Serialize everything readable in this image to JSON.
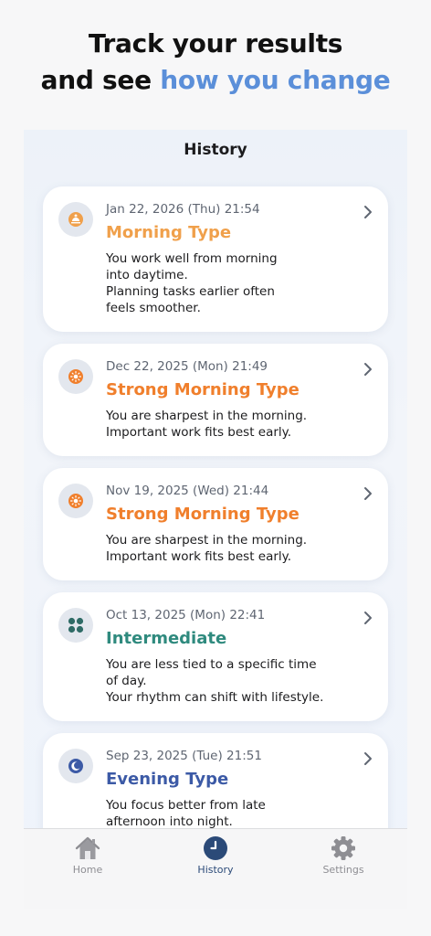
{
  "promo": {
    "line1": "Track your results",
    "line2_prefix": "and see ",
    "line2_accent": "how you change"
  },
  "screen": {
    "title": "History"
  },
  "history": [
    {
      "date": "Jan 22, 2026 (Thu) 21:54",
      "type": "Morning Type",
      "type_color": "#f0a04b",
      "icon": "sunrise-icon",
      "description": [
        "You work well from morning",
        "into daytime.",
        "Planning tasks earlier often",
        "feels smoother."
      ]
    },
    {
      "date": "Dec 22, 2025 (Mon) 21:49",
      "type": "Strong Morning Type",
      "type_color": "#f07f2c",
      "icon": "sun-icon",
      "description": [
        "You are sharpest in the morning.",
        "Important work fits best early."
      ]
    },
    {
      "date": "Nov 19, 2025 (Wed) 21:44",
      "type": "Strong Morning Type",
      "type_color": "#f07f2c",
      "icon": "sun-icon",
      "description": [
        "You are sharpest in the morning.",
        "Important work fits best early."
      ]
    },
    {
      "date": "Oct 13, 2025 (Mon) 22:41",
      "type": "Intermediate",
      "type_color": "#2f8a7e",
      "icon": "four-dots-icon",
      "description": [
        "You are less tied to a specific time",
        "of day.",
        "Your rhythm can shift with lifestyle."
      ]
    },
    {
      "date": "Sep 23, 2025 (Tue) 21:51",
      "type": "Evening Type",
      "type_color": "#3c5aa6",
      "icon": "moon-icon",
      "description": [
        "You focus better from late",
        "afternoon into night."
      ]
    }
  ],
  "tabs": [
    {
      "label": "Home",
      "icon": "home-icon",
      "active": false
    },
    {
      "label": "History",
      "icon": "clock-icon",
      "active": true
    },
    {
      "label": "Settings",
      "icon": "gear-icon",
      "active": false
    }
  ]
}
